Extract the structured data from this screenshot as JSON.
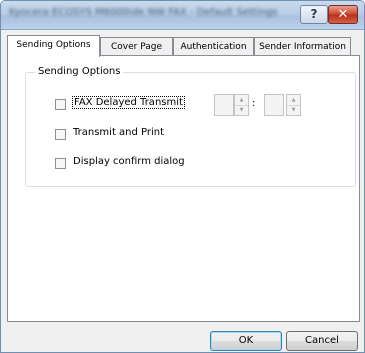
{
  "window": {
    "title": "Kyocera ECOSYS M6000ide NW FAX - Default Settings",
    "help_label": "?",
    "close_label": "✕"
  },
  "tabs": [
    {
      "label": "Sending Options",
      "active": true
    },
    {
      "label": "Cover Page",
      "active": false
    },
    {
      "label": "Authentication",
      "active": false
    },
    {
      "label": "Sender Information",
      "active": false
    }
  ],
  "group": {
    "label": "Sending Options",
    "options": [
      {
        "label": "FAX Delayed Transmit",
        "checked": false
      },
      {
        "label": "Transmit and Print",
        "checked": false
      },
      {
        "label": "Display confirm dialog",
        "checked": false
      }
    ],
    "time_separator": ":",
    "hour_value": "",
    "minute_value": ""
  },
  "buttons": {
    "ok": "OK",
    "cancel": "Cancel"
  },
  "icons": {
    "help": "question-mark-icon",
    "close": "close-icon",
    "spin_up": "chevron-up-icon",
    "spin_down": "chevron-down-icon"
  }
}
